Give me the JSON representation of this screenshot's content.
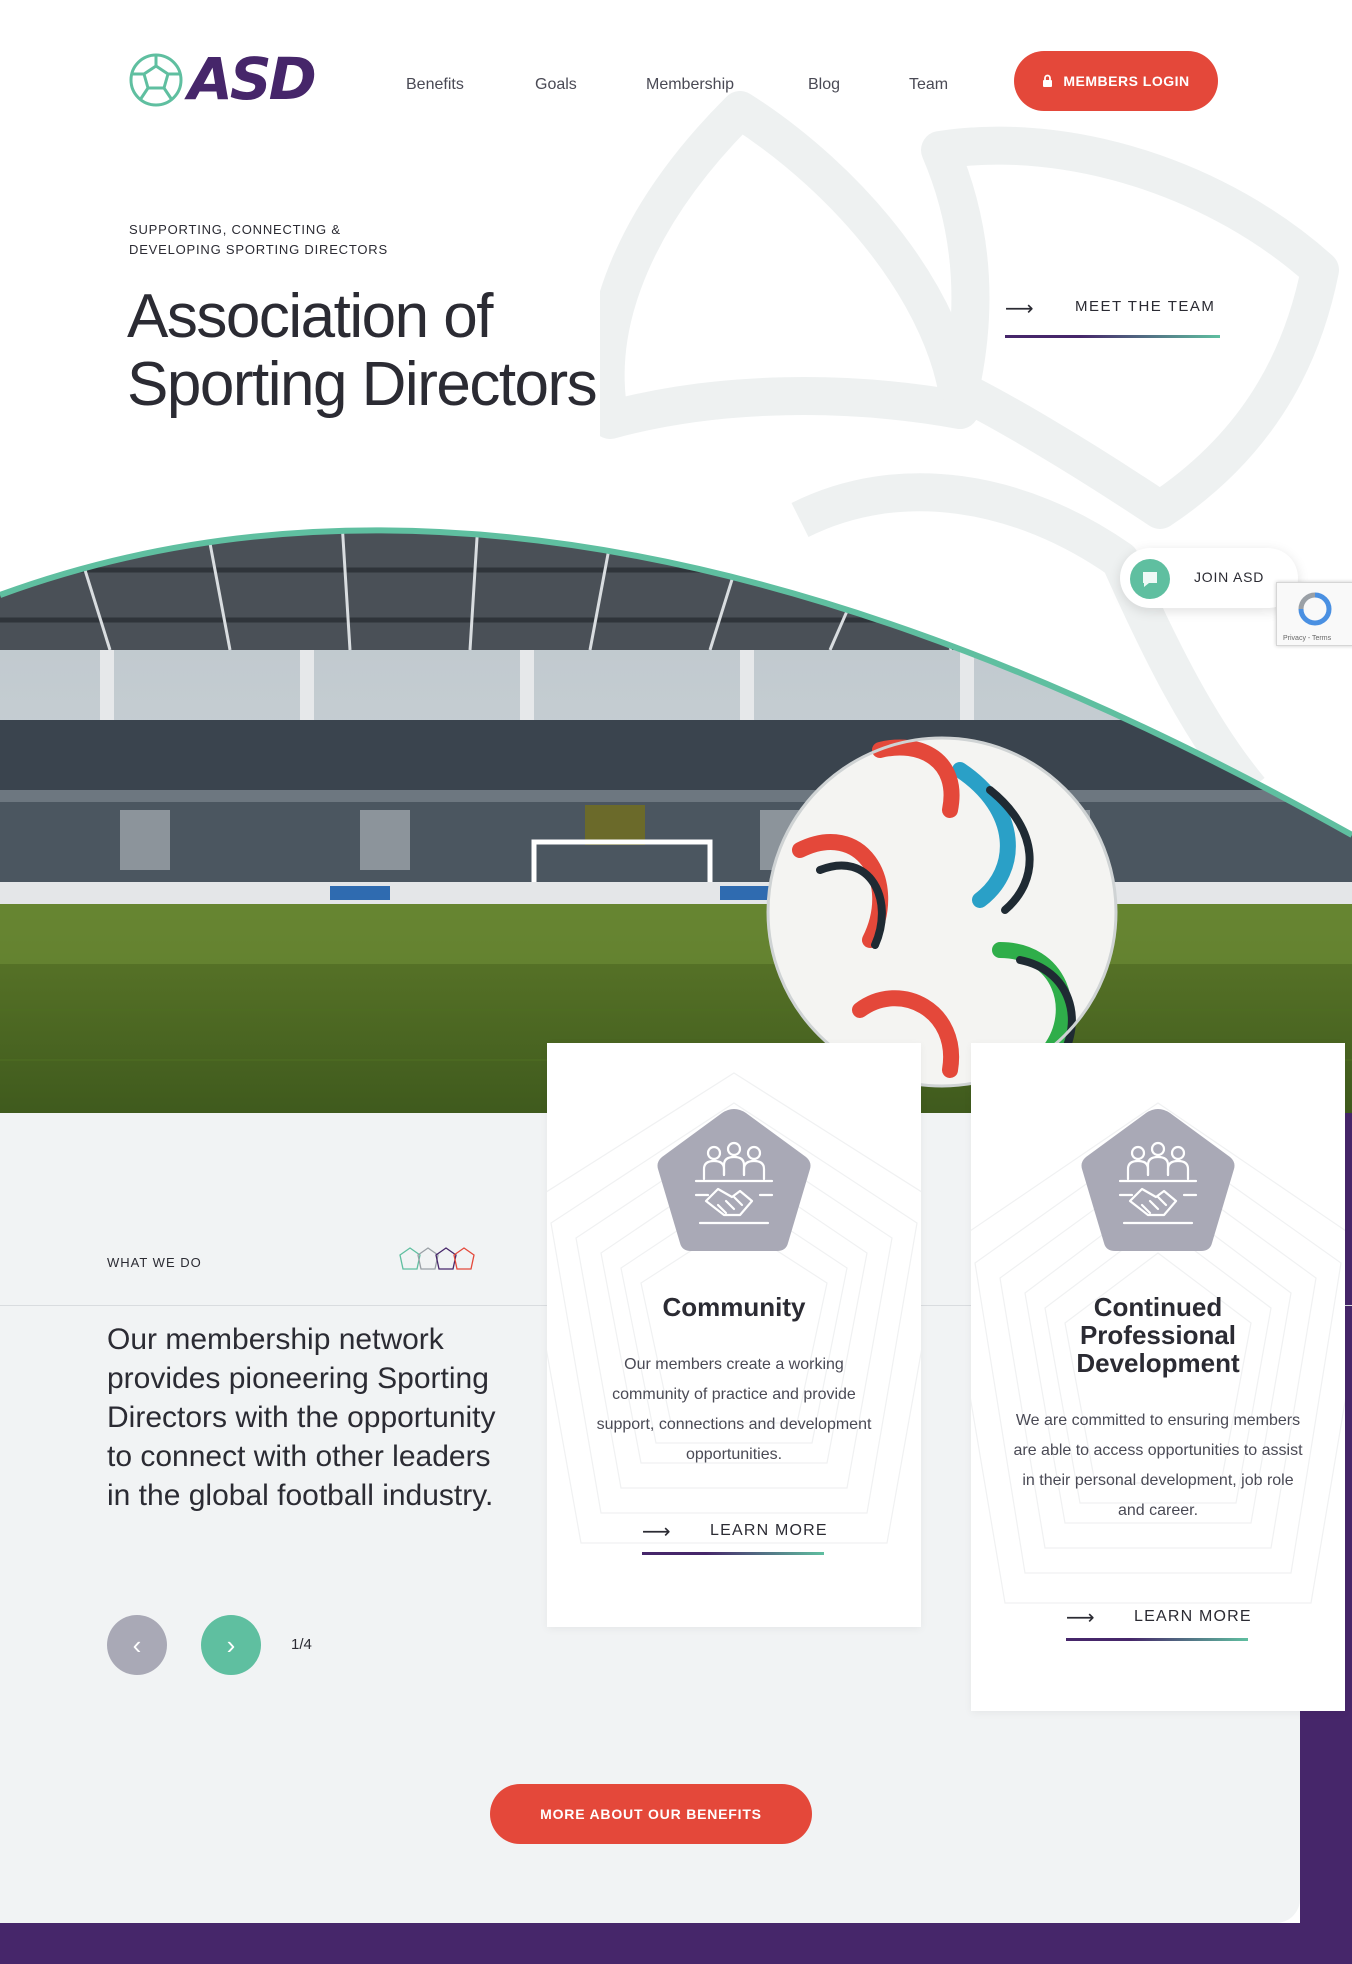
{
  "header": {
    "logo_text": "ASD",
    "nav": [
      "Benefits",
      "Goals",
      "Membership",
      "Blog",
      "Team"
    ],
    "login_label": "MEMBERS LOGIN"
  },
  "hero": {
    "tagline_line1": "SUPPORTING, CONNECTING &",
    "tagline_line2": "DEVELOPING SPORTING DIRECTORS",
    "headline_line1": "Association of",
    "headline_line2": "Sporting Directors",
    "cta_label": "MEET THE TEAM",
    "arrow_glyph": "⟶"
  },
  "join_widget": {
    "label": "JOIN ASD"
  },
  "recaptcha": {
    "text": "Privacy - Terms"
  },
  "what_we_do": {
    "eyebrow": "WHAT WE DO",
    "copy": "Our membership network provides pioneering Sporting Directors with the opportunity to connect with other leaders in the global football industry.",
    "pager": "1/4",
    "prev_glyph": "‹",
    "next_glyph": "›"
  },
  "cards": [
    {
      "title": "Community",
      "description": "Our members create a working community of practice and provide support, connections and development opportunities.",
      "link_label": "LEARN MORE"
    },
    {
      "title_line1": "Continued",
      "title_line2": "Professional",
      "title_line3": "Development",
      "description": "We are committed to ensuring members are able to access opportunities to assist in their personal development, job role and career.",
      "link_label": "LEARN MORE"
    }
  ],
  "benefits_button": {
    "label": "MORE ABOUT OUR BENEFITS"
  },
  "colors": {
    "brand_purple": "#46266a",
    "brand_teal": "#5fbfa0",
    "cta_red": "#e4483a",
    "icon_grey": "#a9a9b6"
  },
  "icons": [
    "logo-icon",
    "lock-icon",
    "arrow-right-icon",
    "chat-bubble-icon",
    "recaptcha-icon",
    "pentagons-icon",
    "chevron-left-icon",
    "chevron-right-icon",
    "team-handshake-icon"
  ]
}
